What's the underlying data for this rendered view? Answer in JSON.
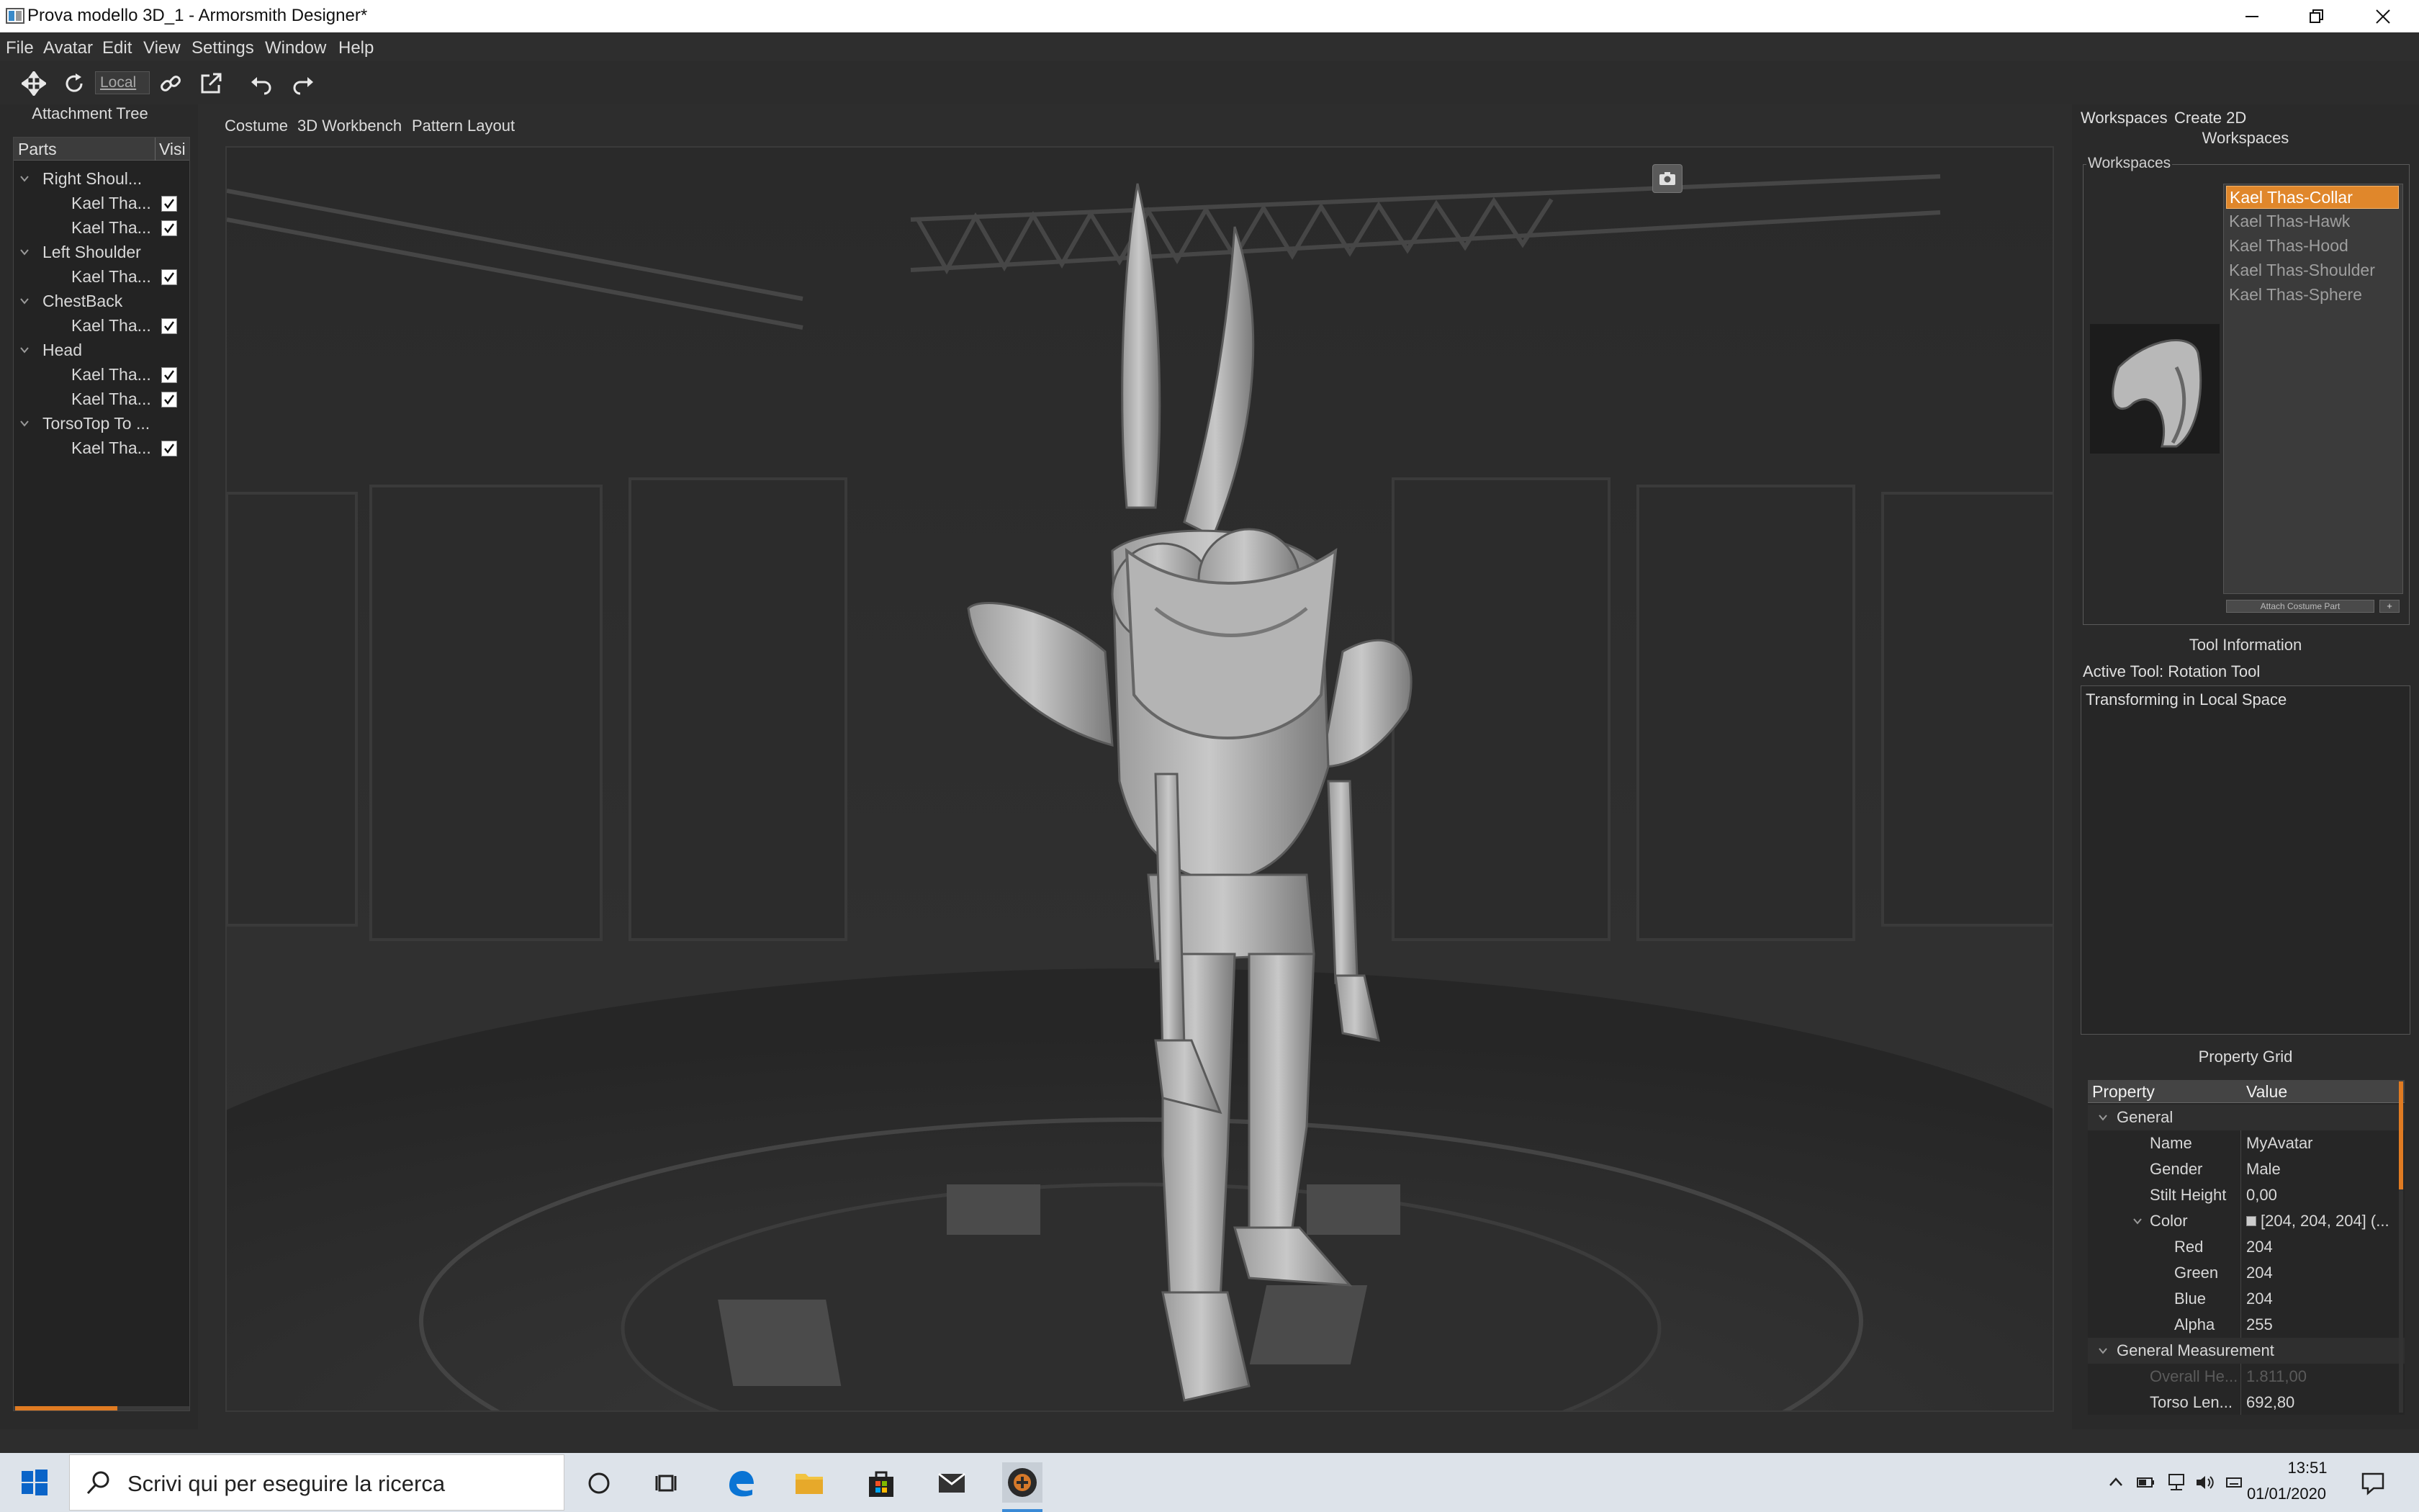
{
  "window": {
    "title": "Prova modello 3D_1 - Armorsmith Designer*"
  },
  "menu": [
    "File",
    "Avatar",
    "Edit",
    "View",
    "Settings",
    "Window",
    "Help"
  ],
  "toolbar": {
    "space_mode": "Local"
  },
  "attachment_tree": {
    "title": "Attachment Tree",
    "columns": [
      "Parts",
      "Visi"
    ],
    "rows": [
      {
        "label": "Right Shoul...",
        "level": 0
      },
      {
        "label": "Kael Tha...",
        "level": 1,
        "checked": true
      },
      {
        "label": "Kael Tha...",
        "level": 1,
        "checked": true
      },
      {
        "label": "Left Shoulder",
        "level": 0
      },
      {
        "label": "Kael Tha...",
        "level": 1,
        "checked": true
      },
      {
        "label": "ChestBack",
        "level": 0
      },
      {
        "label": "Kael Tha...",
        "level": 1,
        "checked": true
      },
      {
        "label": "Head",
        "level": 0
      },
      {
        "label": "Kael Tha...",
        "level": 1,
        "checked": true
      },
      {
        "label": "Kael Tha...",
        "level": 1,
        "checked": true
      },
      {
        "label": "TorsoTop To ...",
        "level": 0
      },
      {
        "label": "Kael Tha...",
        "level": 1,
        "checked": true
      }
    ]
  },
  "center_tabs": [
    "Costume",
    "3D Workbench",
    "Pattern Layout"
  ],
  "right_panel": {
    "tabs": [
      "Workspaces",
      "Create 2D"
    ],
    "workspaces_title": "Workspaces",
    "workspaces_group_label": "Workspaces",
    "workspace_items": [
      "Kael Thas-Collar",
      "Kael Thas-Hawk",
      "Kael Thas-Hood",
      "Kael Thas-Shoulder",
      "Kael Thas-Sphere"
    ],
    "selected_workspace": "Kael Thas-Collar",
    "attach_button": "Attach Costume Part",
    "add_button": "+",
    "tool_info_title": "Tool Information",
    "active_tool": "Active Tool: Rotation Tool",
    "tool_info_text": "Transforming in Local Space",
    "property_grid_title": "Property Grid",
    "property_columns": [
      "Property",
      "Value"
    ],
    "properties": [
      {
        "name": "General",
        "value": "",
        "type": "category"
      },
      {
        "name": "Name",
        "value": "MyAvatar"
      },
      {
        "name": "Gender",
        "value": "Male"
      },
      {
        "name": "Stilt Height",
        "value": "0,00"
      },
      {
        "name": "Color",
        "value": "[204, 204, 204] (...",
        "type": "subcategory"
      },
      {
        "name": "Red",
        "value": "204",
        "type": "child"
      },
      {
        "name": "Green",
        "value": "204",
        "type": "child"
      },
      {
        "name": "Blue",
        "value": "204",
        "type": "child"
      },
      {
        "name": "Alpha",
        "value": "255",
        "type": "child"
      },
      {
        "name": "General Measurement",
        "value": "",
        "type": "category"
      },
      {
        "name": "Overall He...",
        "value": "1.811,00",
        "type": "disabled"
      },
      {
        "name": "Torso Len...",
        "value": "692,80"
      }
    ]
  },
  "taskbar": {
    "search_placeholder": "Scrivi qui per eseguire la ricerca",
    "time": "13:51",
    "date": "01/01/2020"
  },
  "colors": {
    "accent": "#e0872b",
    "panel": "#2a2a2a",
    "viewport": "#2f2f2f",
    "taskbar": "#dde3ea"
  }
}
